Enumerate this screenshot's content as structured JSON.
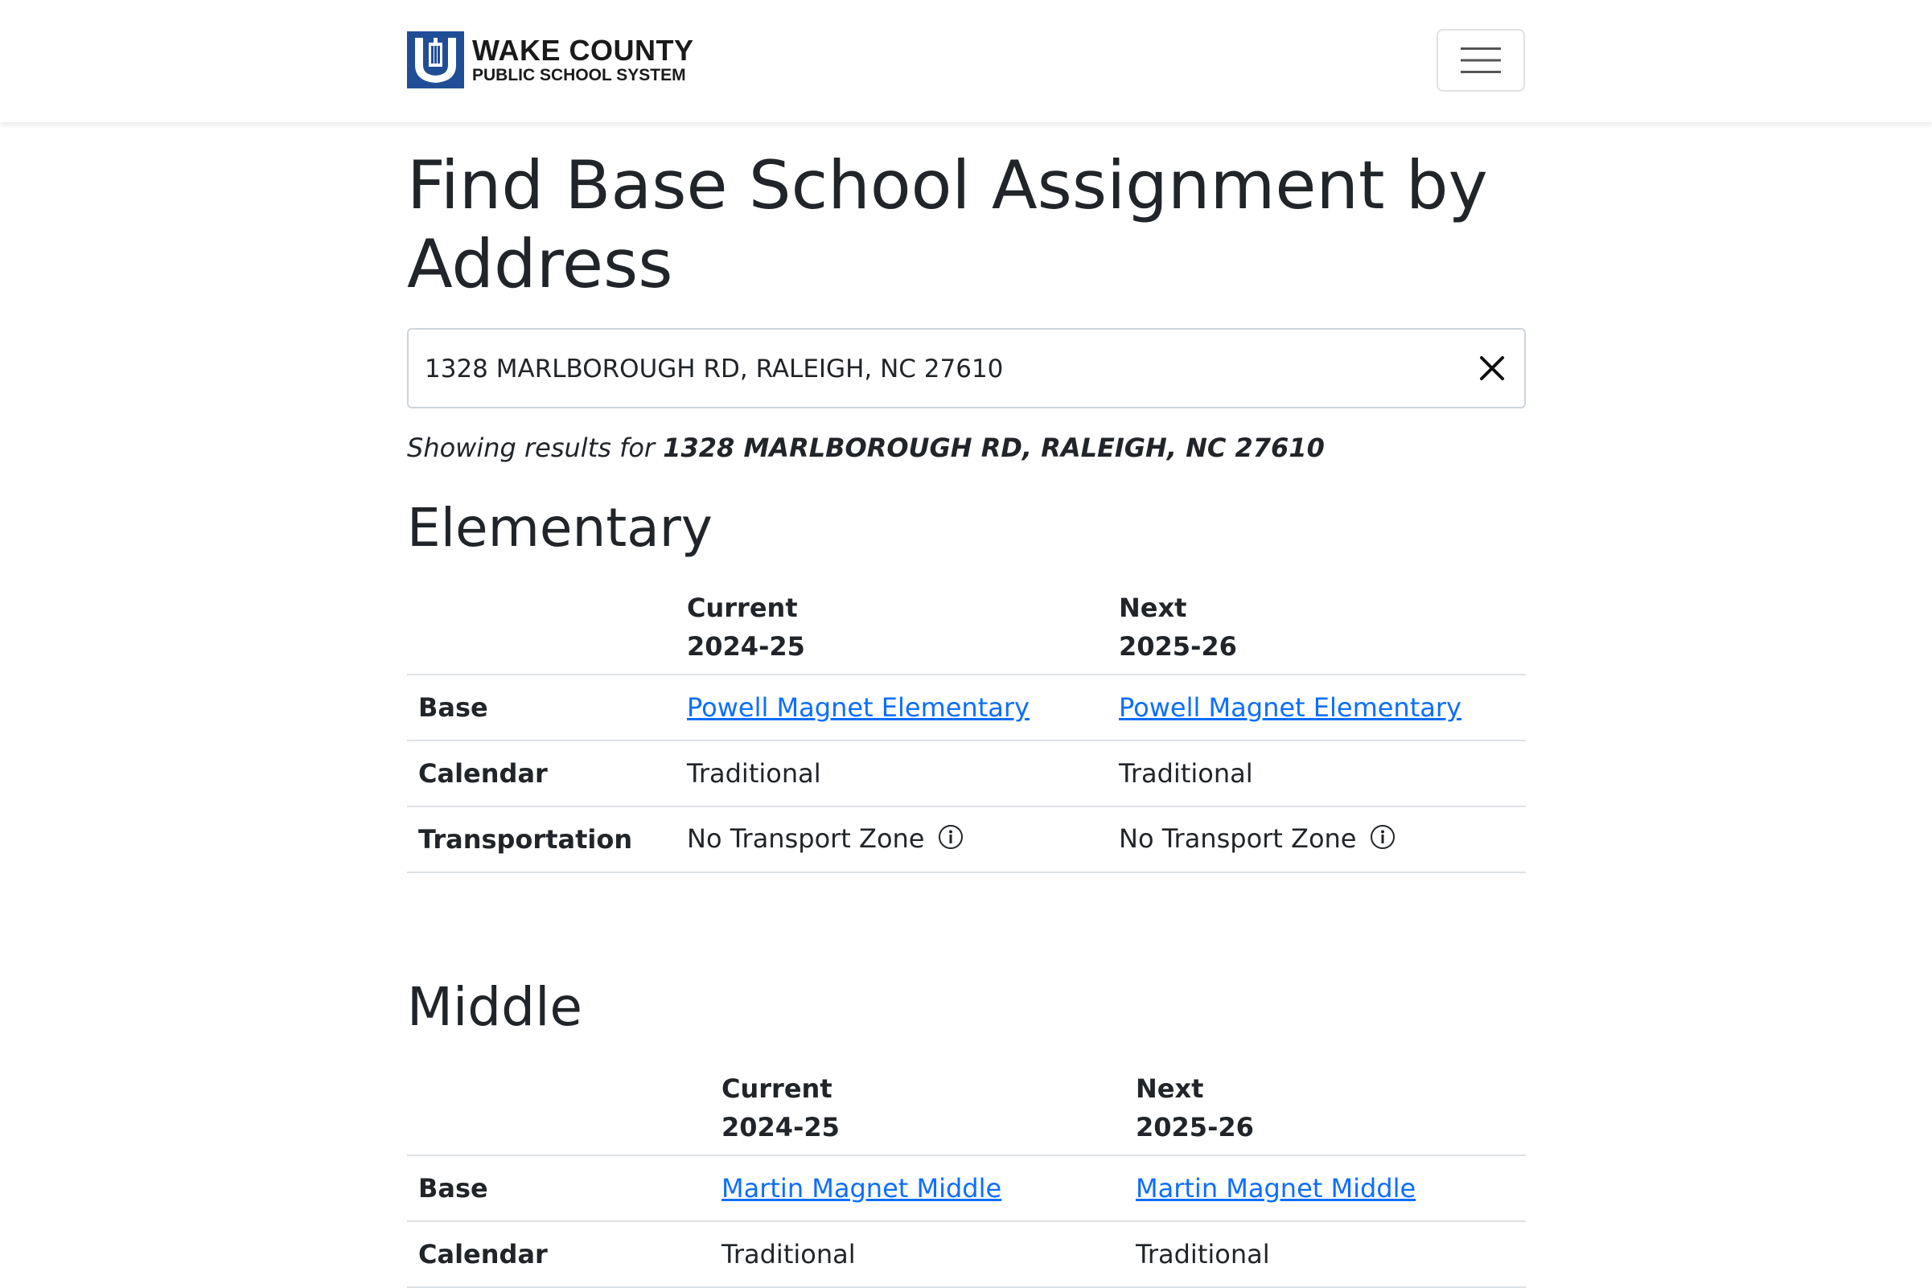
{
  "header": {
    "logo_line1": "WAKE COUNTY",
    "logo_line2": "PUBLIC SCHOOL SYSTEM",
    "brand_color": "#1f4e96",
    "menu_icon": "hamburger-icon"
  },
  "page": {
    "title": "Find Base School Assignment by Address"
  },
  "search": {
    "value": "1328 MARLBOROUGH RD, RALEIGH, NC 27610",
    "clear_icon": "close-icon"
  },
  "results": {
    "prefix": "Showing results for",
    "address": "1328 MARLBOROUGH RD, RALEIGH, NC 27610"
  },
  "colors": {
    "link": "#0d6efd",
    "text": "#212529",
    "border": "#dee2e6"
  },
  "sections": {
    "elementary": {
      "heading": "Elementary",
      "current_label": "Current",
      "current_year": "2024-25",
      "next_label": "Next",
      "next_year": "2025-26",
      "rows": {
        "base": {
          "label": "Base",
          "current": "Powell Magnet Elementary",
          "next": "Powell Magnet Elementary"
        },
        "calendar": {
          "label": "Calendar",
          "current": "Traditional",
          "next": "Traditional"
        },
        "transportation": {
          "label": "Transportation",
          "current": "No Transport Zone",
          "next": "No Transport Zone"
        }
      }
    },
    "middle": {
      "heading": "Middle",
      "current_label": "Current",
      "current_year": "2024-25",
      "next_label": "Next",
      "next_year": "2025-26",
      "rows": {
        "base": {
          "label": "Base",
          "current": "Martin Magnet Middle",
          "next": "Martin Magnet Middle"
        },
        "calendar": {
          "label": "Calendar",
          "current": "Traditional",
          "next": "Traditional"
        }
      }
    }
  }
}
